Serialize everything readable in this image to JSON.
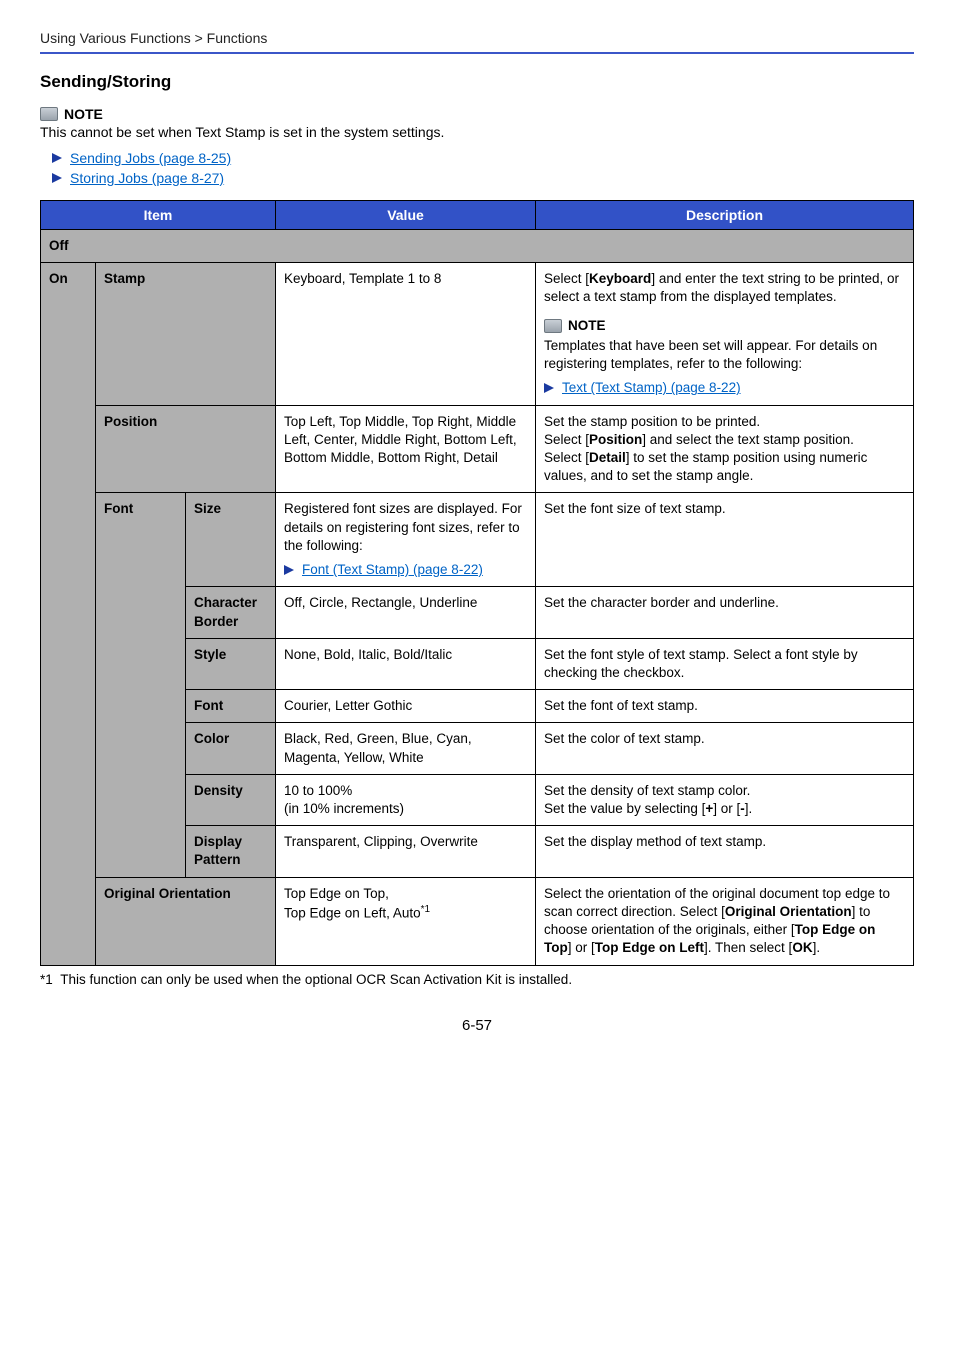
{
  "breadcrumb": "Using Various Functions > Functions",
  "section_title": "Sending/Storing",
  "top_note_label": "NOTE",
  "top_note_text": "This cannot be set when Text Stamp is set in the system settings.",
  "links": {
    "sending": "Sending Jobs (page 8-25)",
    "storing": "Storing Jobs (page 8-27)",
    "text_stamp": "Text (Text Stamp) (page 8-22)",
    "font_stamp": "Font (Text Stamp) (page 8-22)"
  },
  "headers": {
    "item": "Item",
    "value": "Value",
    "description": "Description"
  },
  "rows": {
    "off": "Off",
    "on": "On",
    "stamp": {
      "label": "Stamp",
      "value": "Keyboard, Template 1 to 8",
      "desc1": "Select [Keyboard] and enter the text string to be printed, or select a text stamp from the displayed templates.",
      "note_label": "NOTE",
      "desc2": "Templates that have been set will appear. For details on registering templates, refer to the following:"
    },
    "position": {
      "label": "Position",
      "value": "Top Left, Top Middle, Top Right, Middle Left, Center, Middle Right, Bottom Left, Bottom Middle, Bottom Right, Detail",
      "desc_a": "Set the stamp position to be printed.",
      "desc_b": "Select [Position] and select the text stamp position.",
      "desc_c": "Select [Detail] to set the stamp position using numeric values, and to set the stamp angle."
    },
    "font_group": "Font",
    "size": {
      "label": "Size",
      "value": "Registered font sizes are displayed. For details on registering font sizes, refer to the following:",
      "desc": "Set the font size of text stamp."
    },
    "border": {
      "label": "Character Border",
      "value": "Off, Circle, Rectangle, Underline",
      "desc": "Set the character border and underline."
    },
    "style": {
      "label": "Style",
      "value": "None, Bold, Italic, Bold/Italic",
      "desc": "Set the font style of text stamp. Select a font style by checking the checkbox."
    },
    "font": {
      "label": "Font",
      "value": "Courier, Letter Gothic",
      "desc": "Set the font of text stamp."
    },
    "color": {
      "label": "Color",
      "value": "Black, Red, Green, Blue, Cyan, Magenta, Yellow, White",
      "desc": "Set the color of text stamp."
    },
    "density": {
      "label": "Density",
      "value_a": "10 to 100%",
      "value_b": "(in 10% increments)",
      "desc_a": "Set the density of text stamp color.",
      "desc_b": "Set the value by selecting [+] or [-]."
    },
    "pattern": {
      "label": "Display Pattern",
      "value": "Transparent, Clipping, Overwrite",
      "desc": "Set the display method of text stamp."
    },
    "orientation": {
      "label": "Original Orientation",
      "value_a": "Top Edge on Top,",
      "value_b": "Top Edge on Left, Auto",
      "sup": "*1",
      "desc": "Select the orientation of the original document top edge to scan correct direction. Select [Original Orientation] to choose orientation of the originals, either [Top Edge on Top] or [Top Edge on Left]. Then select [OK]."
    }
  },
  "footnote_marker": "*1",
  "footnote": "This function can only be used when the optional OCR Scan Activation Kit is installed.",
  "page_number": "6-57"
}
